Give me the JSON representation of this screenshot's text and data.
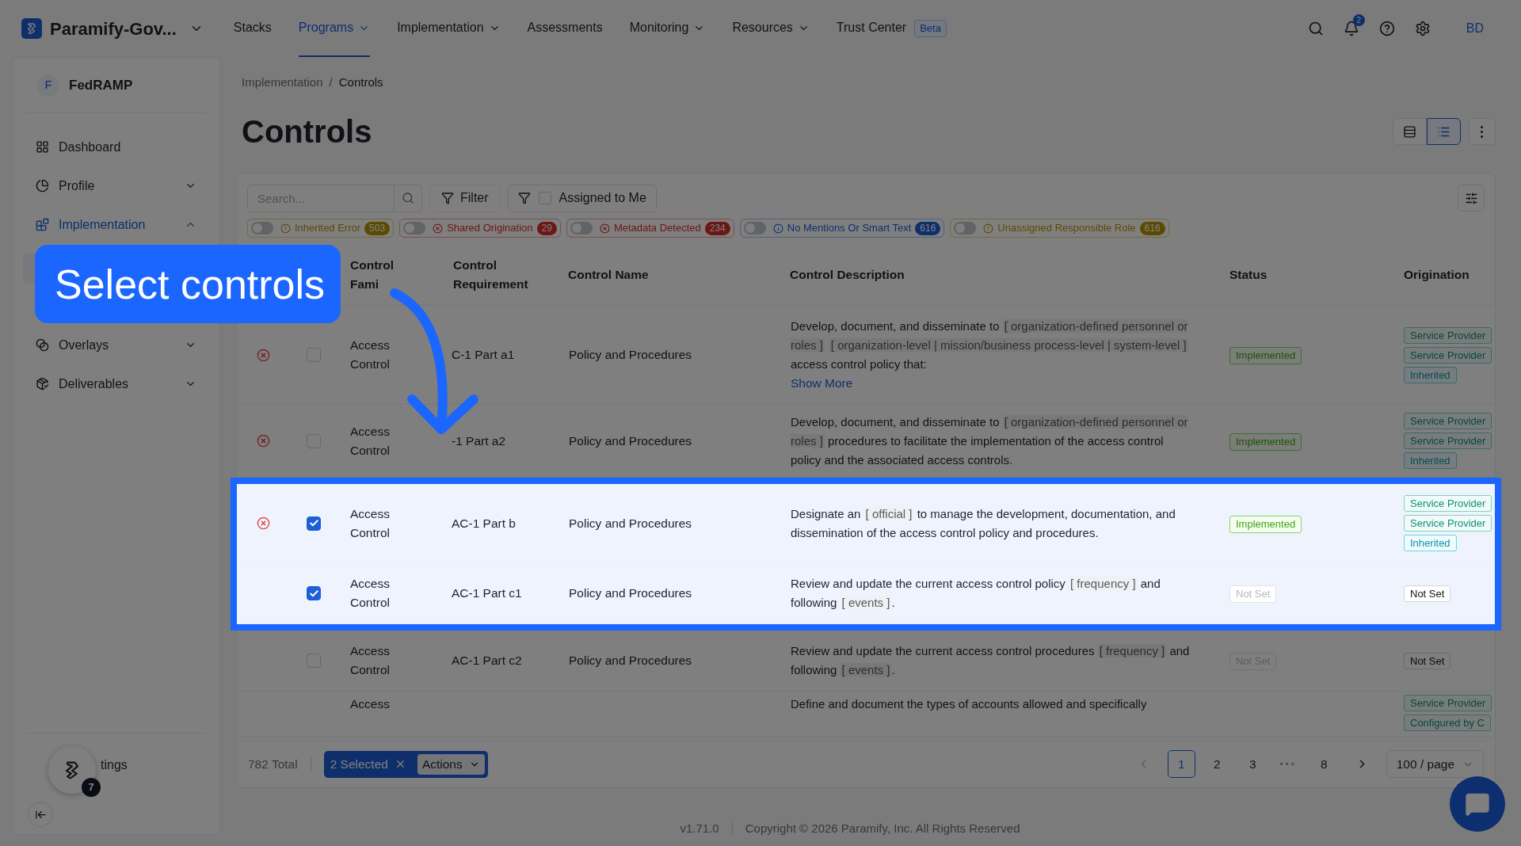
{
  "header": {
    "app_name": "Paramify-Gov...",
    "nav": [
      {
        "label": "Stacks",
        "selected": false,
        "dropdown": false
      },
      {
        "label": "Programs",
        "selected": true,
        "dropdown": true
      },
      {
        "label": "Implementation",
        "selected": false,
        "dropdown": true
      },
      {
        "label": "Assessments",
        "selected": false,
        "dropdown": false
      },
      {
        "label": "Monitoring",
        "selected": false,
        "dropdown": true
      },
      {
        "label": "Resources",
        "selected": false,
        "dropdown": true
      },
      {
        "label": "Trust Center",
        "selected": false,
        "dropdown": false,
        "badge": "Beta"
      }
    ],
    "notification_count": "2",
    "user_initials": "BD"
  },
  "sidebar": {
    "program_initial": "F",
    "program_name": "FedRAMP",
    "items": [
      {
        "label": "Dashboard",
        "kind": "link",
        "selected": false
      },
      {
        "label": "Profile",
        "kind": "group",
        "selected": false,
        "expanded": false
      },
      {
        "label": "Implementation",
        "kind": "group",
        "selected": true,
        "expanded": true
      },
      {
        "label": "Overlays",
        "kind": "group",
        "selected": false,
        "expanded": false
      },
      {
        "label": "Deliverables",
        "kind": "group",
        "selected": false,
        "expanded": false
      }
    ],
    "settings_label": "tings",
    "assistant_badge": "7"
  },
  "breadcrumb": [
    "Implementation",
    "Controls"
  ],
  "breadcrumb_separator": "/",
  "page_title": "Controls",
  "toolbar": {
    "search": {
      "placeholder": "Search..."
    },
    "filter_label": "Filter",
    "assigned_to_me": {
      "label": "Assigned to Me",
      "checked": false
    }
  },
  "quick_filters": [
    {
      "label": "Inherited Error",
      "count": "503",
      "on": false,
      "kind": "warning"
    },
    {
      "label": "Shared Origination",
      "count": "29",
      "on": false,
      "kind": "error"
    },
    {
      "label": "Metadata Detected",
      "count": "234",
      "on": false,
      "kind": "error"
    },
    {
      "label": "No Mentions Or Smart Text",
      "count": "616",
      "on": false,
      "kind": "info"
    },
    {
      "label": "Unassigned Responsible Role",
      "count": "616",
      "on": false,
      "kind": "warning"
    }
  ],
  "table": {
    "columns": [
      "Control Fami",
      "Control Requirement",
      "Control Name",
      "Control Description",
      "Status",
      "Origination"
    ],
    "rows": [
      {
        "error": true,
        "checked": false,
        "highlighted": false,
        "family": "Access Control",
        "requirement": "C-1 Part a1",
        "name": "Policy and Procedures",
        "description": [
          {
            "kind": "plain",
            "text": "Develop, document, and disseminate to "
          },
          {
            "kind": "param",
            "text": "[ organization-defined personnel or roles ]"
          },
          {
            "kind": "param",
            "text": "[ organization-level | mission/business process-level | system-level ]"
          },
          {
            "kind": "plain",
            "text": " access control policy that:"
          }
        ],
        "show_more": "Show More",
        "status": {
          "label": "Implemented",
          "kind": "implemented"
        },
        "origination": [
          {
            "label": "Service Provider",
            "kind": "provider"
          },
          {
            "label": "Service Provider",
            "kind": "provider"
          },
          {
            "label": "Inherited",
            "kind": "inherited"
          }
        ]
      },
      {
        "error": true,
        "checked": false,
        "highlighted": false,
        "family": "Access Control",
        "requirement": "-1 Part a2",
        "name": "Policy and Procedures",
        "description": [
          {
            "kind": "plain",
            "text": "Develop, document, and disseminate to "
          },
          {
            "kind": "param",
            "text": "[ organization-defined personnel or roles ]"
          },
          {
            "kind": "plain",
            "text": " procedures to facilitate the implementation of the access control policy and the associated access controls."
          }
        ],
        "status": {
          "label": "Implemented",
          "kind": "implemented"
        },
        "origination": [
          {
            "label": "Service Provider",
            "kind": "provider"
          },
          {
            "label": "Service Provider",
            "kind": "provider"
          },
          {
            "label": "Inherited",
            "kind": "inherited"
          }
        ]
      },
      {
        "error": true,
        "checked": true,
        "highlighted": true,
        "family": "Access Control",
        "requirement": "AC-1 Part b",
        "name": "Policy and Procedures",
        "description": [
          {
            "kind": "plain",
            "text": "Designate an "
          },
          {
            "kind": "param",
            "text": "[ official ]"
          },
          {
            "kind": "plain",
            "text": " to manage the development, documentation, and dissemination of the access control policy and procedures."
          }
        ],
        "status": {
          "label": "Implemented",
          "kind": "implemented"
        },
        "origination": [
          {
            "label": "Service Provider",
            "kind": "provider"
          },
          {
            "label": "Service Provider",
            "kind": "provider"
          },
          {
            "label": "Inherited",
            "kind": "inherited"
          }
        ]
      },
      {
        "error": false,
        "checked": true,
        "highlighted": true,
        "family": "Access Control",
        "requirement": "AC-1 Part c1",
        "name": "Policy and Procedures",
        "description": [
          {
            "kind": "plain",
            "text": "Review and update the current access control policy "
          },
          {
            "kind": "param",
            "text": "[ frequency ]"
          },
          {
            "kind": "plain",
            "text": " and following "
          },
          {
            "kind": "param",
            "text": "[ events ]"
          },
          {
            "kind": "plain",
            "text": "."
          }
        ],
        "status": {
          "label": "Not Set",
          "kind": "not_set"
        },
        "origination": [
          {
            "label": "Not Set",
            "kind": "not_set"
          }
        ]
      },
      {
        "error": false,
        "checked": false,
        "highlighted": false,
        "family": "Access Control",
        "requirement": "AC-1 Part c2",
        "name": "Policy and Procedures",
        "description": [
          {
            "kind": "plain",
            "text": "Review and update the current access control procedures "
          },
          {
            "kind": "param",
            "text": "[ frequency ]"
          },
          {
            "kind": "plain",
            "text": " and following "
          },
          {
            "kind": "param",
            "text": "[ events ]"
          },
          {
            "kind": "plain",
            "text": "."
          }
        ],
        "status": {
          "label": "Not Set",
          "kind": "not_set"
        },
        "origination": [
          {
            "label": "Not Set",
            "kind": "not_set"
          }
        ]
      },
      {
        "error": false,
        "highlighted": false,
        "family": "Access",
        "description": [
          {
            "kind": "plain",
            "text": "Define and document the types of accounts allowed and specifically"
          }
        ],
        "origination": [
          {
            "label": "Service Provider",
            "kind": "provider"
          },
          {
            "label": "Configured by C",
            "kind": "configured"
          }
        ]
      }
    ]
  },
  "table_footer": {
    "total": "782 Total",
    "selected": "2 Selected",
    "actions": "Actions",
    "pages": [
      {
        "label": "1",
        "selected": true,
        "kind": "page"
      },
      {
        "label": "2",
        "selected": false,
        "kind": "page"
      },
      {
        "label": "3",
        "selected": false,
        "kind": "page"
      },
      {
        "label": "•••",
        "selected": false,
        "kind": "ellipsis"
      },
      {
        "label": "8",
        "selected": false,
        "kind": "page"
      }
    ],
    "page_size": "100 / page"
  },
  "app_footer": {
    "version": "v1.71.0",
    "copyright": "Copyright © 2026 Paramify, Inc. All Rights Reserved"
  },
  "tour": {
    "callout": "Select controls"
  }
}
